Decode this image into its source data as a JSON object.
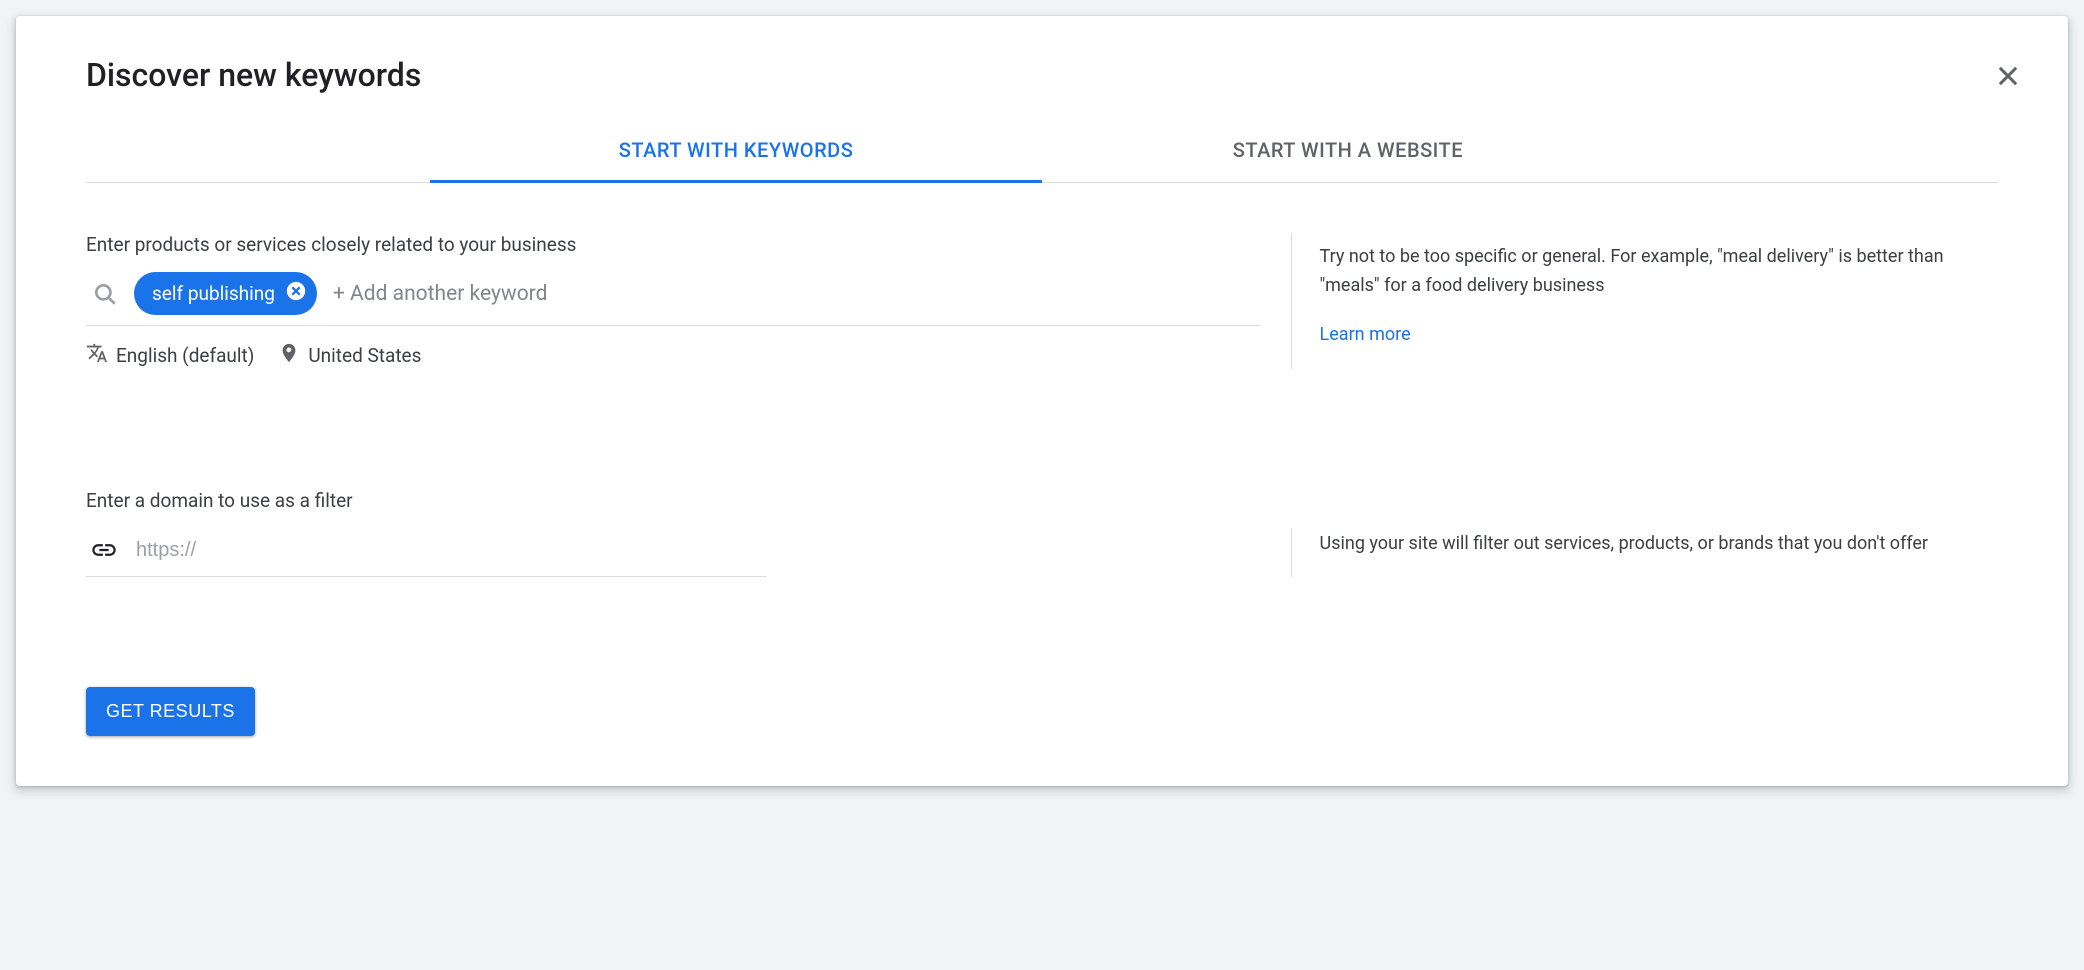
{
  "dialog": {
    "title": "Discover new keywords"
  },
  "tabs": {
    "keywords": "Start with keywords",
    "website": "Start with a website"
  },
  "keywords_section": {
    "label": "Enter products or services closely related to your business",
    "chip": "self publishing",
    "add_placeholder": "+ Add another keyword",
    "language": "English (default)",
    "location": "United States",
    "tip": "Try not to be too specific or general. For example, \"meal delivery\" is better than \"meals\" for a food delivery business",
    "learn_more": "Learn more"
  },
  "domain_section": {
    "label": "Enter a domain to use as a filter",
    "placeholder": "https://",
    "tip": "Using your site will filter out services, products, or brands that you don't offer"
  },
  "actions": {
    "get_results": "Get results"
  }
}
